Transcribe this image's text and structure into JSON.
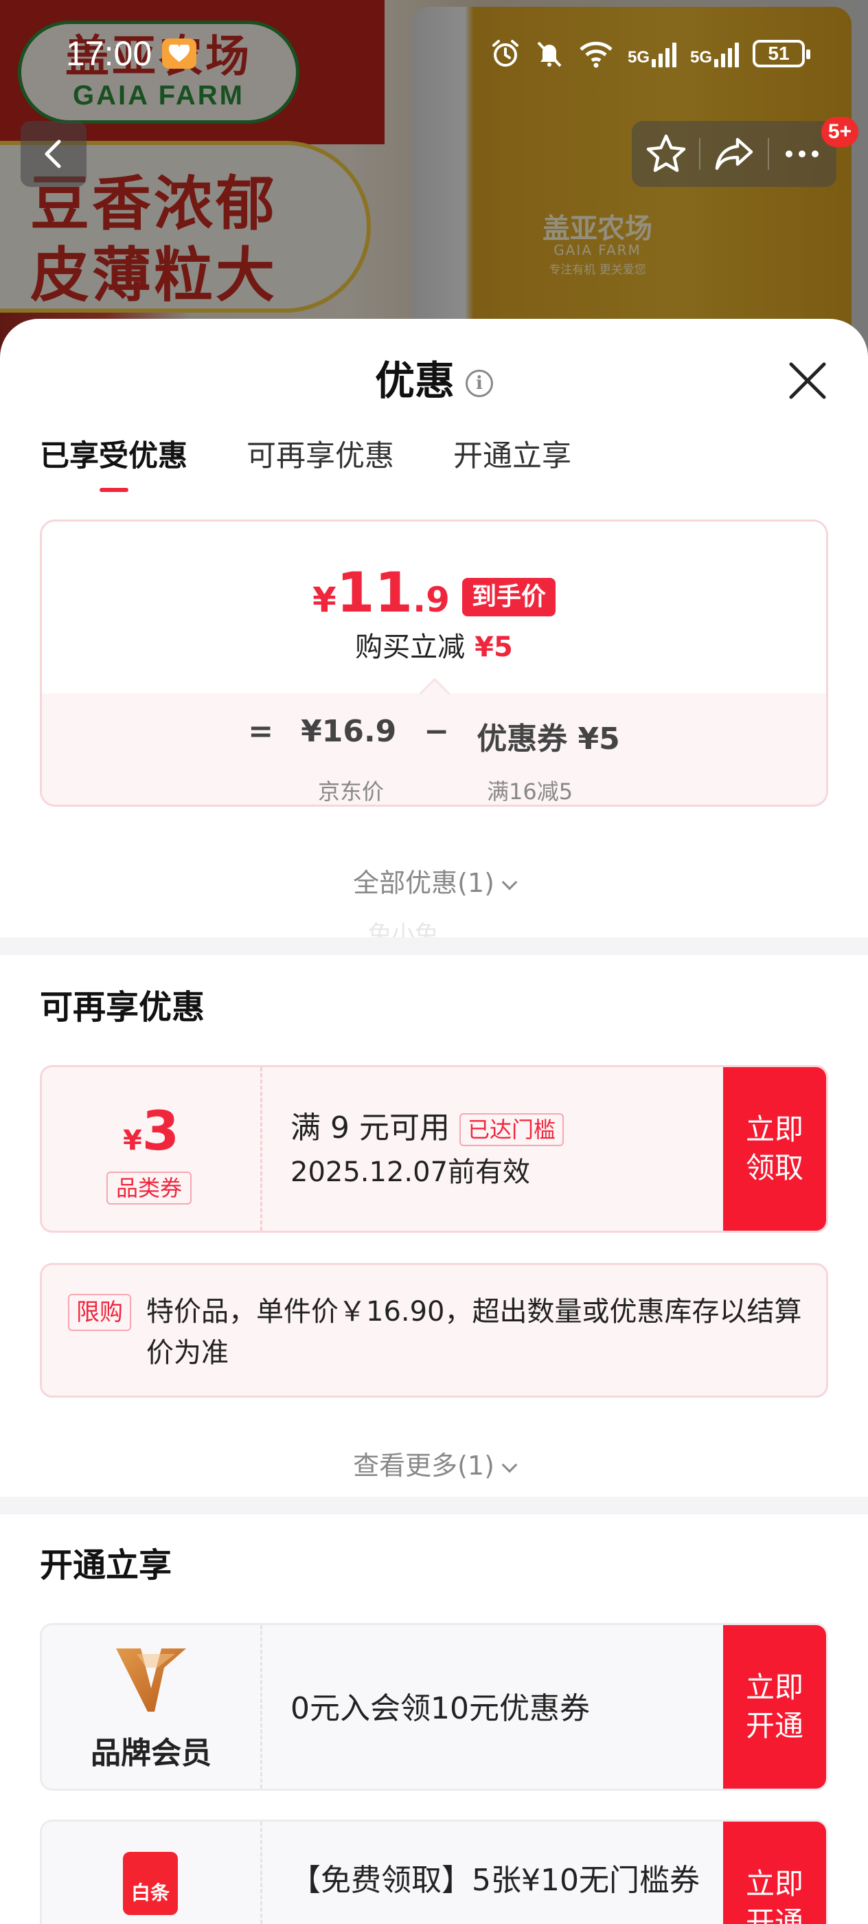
{
  "status_bar": {
    "time": "17:00",
    "network_1": "5G",
    "network_2": "5G",
    "battery": "51"
  },
  "header": {
    "badge": "5+"
  },
  "product_banner": {
    "logo_cn": "盖亚农场",
    "logo_en": "GAIA FARM",
    "slogan_line1": "豆香浓郁",
    "slogan_line2": "皮薄粒大",
    "bag_brand": "盖亚农场",
    "bag_brand_en": "GAIA FARM",
    "bag_tagline": "专注有机 更关爱您"
  },
  "sheet": {
    "title": "优惠",
    "info_icon": "i",
    "tabs": [
      {
        "label": "已享受优惠",
        "active": true
      },
      {
        "label": "可再享优惠",
        "active": false
      },
      {
        "label": "开通立享",
        "active": false
      }
    ],
    "price_card": {
      "currency": "¥",
      "price_int": "11",
      "price_dec": ".9",
      "price_tag": "到手价",
      "save_label": "购买立减",
      "save_amount": "¥5",
      "eq": "=",
      "jd_price": "¥16.9",
      "minus": "−",
      "coupon_label": "优惠券 ¥5",
      "jd_price_label": "京东价",
      "coupon_rule": "满16减5"
    },
    "all_discounts": "全部优惠(1)",
    "watermark": "兔小兔",
    "more_section": {
      "title": "可再享优惠",
      "coupon": {
        "currency": "¥",
        "value": "3",
        "type": "品类券",
        "condition": "满 9 元可用",
        "reached": "已达门槛",
        "validity": "2025.12.07前有效",
        "cta": "立即领取"
      },
      "limit": {
        "tag": "限购",
        "text": "特价品，单件价￥16.90，超出数量或优惠库存以结算价为准"
      },
      "see_more": "查看更多(1)"
    },
    "open_section": {
      "title": "开通立享",
      "items": [
        {
          "name": "品牌会员",
          "desc": "0元入会领10元优惠券",
          "cta": "立即开通"
        },
        {
          "icon_text": "白条",
          "desc": "【免费领取】5张¥10无门槛券",
          "cta": "立即开通"
        }
      ]
    }
  },
  "colors": {
    "accent_red": "#f0263c",
    "cta_red": "#f51a30",
    "coupon_bg": "#fdf4f5"
  }
}
